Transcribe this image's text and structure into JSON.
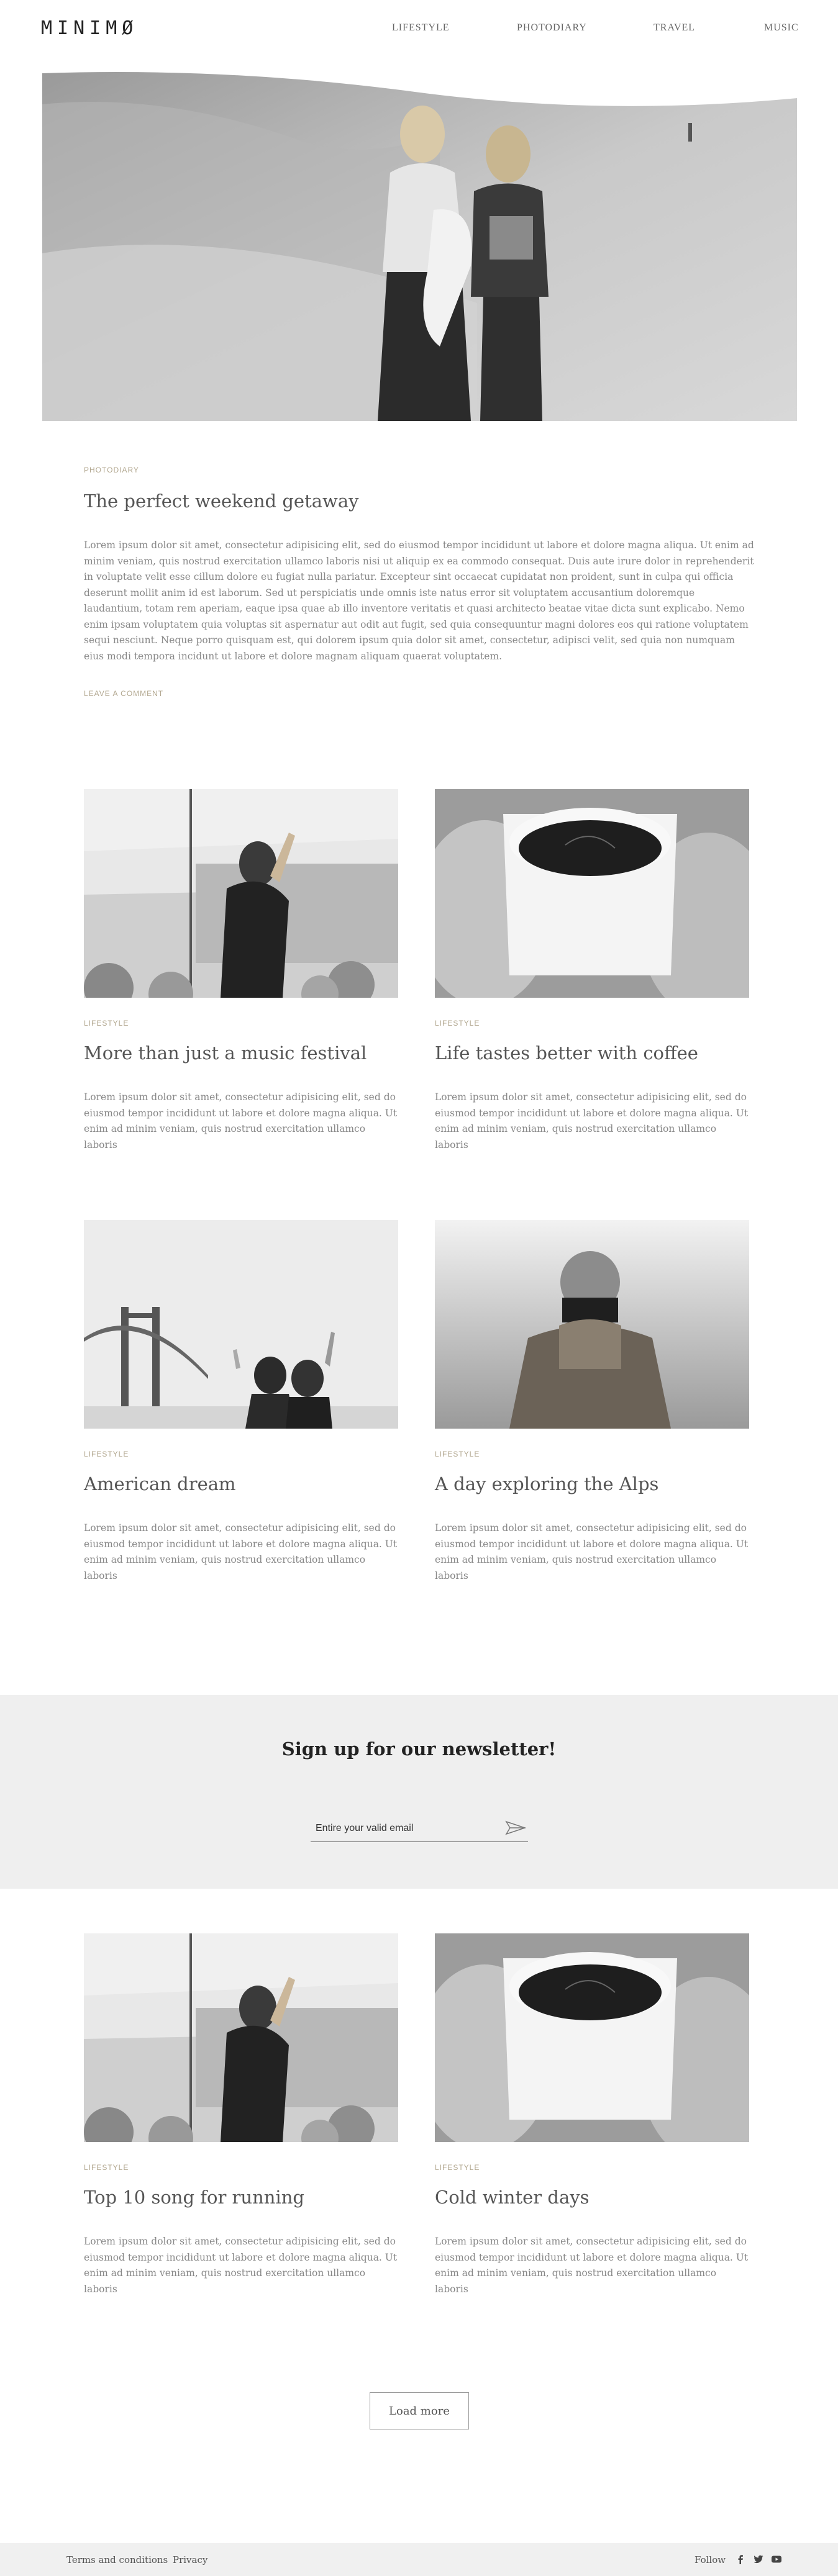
{
  "header": {
    "logo": "MINIMØ",
    "nav": [
      "LIFESTYLE",
      "PHOTODIARY",
      "TRAVEL",
      "MUSIC"
    ]
  },
  "featured": {
    "category": "PHOTODIARY",
    "title": "The perfect weekend getaway",
    "body": "Lorem ipsum dolor sit amet, consectetur adipisicing elit, sed do eiusmod tempor incididunt ut labore et dolore magna aliqua. Ut enim ad minim veniam, quis nostrud exercitation ullamco laboris nisi ut aliquip ex ea commodo consequat. Duis aute irure dolor in reprehenderit in voluptate velit esse cillum dolore eu fugiat nulla pariatur. Excepteur sint occaecat cupidatat non proident, sunt in culpa qui officia deserunt mollit anim id est laborum. Sed ut perspiciatis unde omnis iste natus error sit voluptatem accusantium doloremque laudantium, totam rem aperiam, eaque ipsa quae ab illo inventore veritatis et quasi architecto beatae vitae dicta sunt explicabo. Nemo enim ipsam voluptatem quia voluptas sit aspernatur aut odit aut fugit, sed quia consequuntur magni dolores eos qui ratione voluptatem sequi nesciunt. Neque porro quisquam est, qui dolorem ipsum quia dolor sit amet, consectetur, adipisci velit, sed quia non numquam eius modi tempora incidunt ut labore et dolore magnam aliquam quaerat voluptatem.",
    "leave_comment": "LEAVE A COMMENT"
  },
  "posts": [
    {
      "category": "LIFESTYLE",
      "title": "More than just a music festival",
      "body": "Lorem ipsum dolor sit amet, consectetur adipisicing elit, sed do eiusmod tempor incididunt ut labore et dolore magna aliqua. Ut enim ad minim veniam, quis nostrud exercitation ullamco laboris"
    },
    {
      "category": "LIFESTYLE",
      "title": "Life tastes better with coffee",
      "body": "Lorem ipsum dolor sit amet, consectetur adipisicing elit, sed do eiusmod tempor incididunt ut labore et dolore magna aliqua. Ut enim ad minim veniam, quis nostrud exercitation ullamco laboris"
    },
    {
      "category": "LIFESTYLE",
      "title": "American dream",
      "body": "Lorem ipsum dolor sit amet, consectetur adipisicing elit, sed do eiusmod tempor incididunt ut labore et dolore magna aliqua. Ut enim ad minim veniam, quis nostrud exercitation ullamco laboris"
    },
    {
      "category": "LIFESTYLE",
      "title": "A day exploring the Alps",
      "body": "Lorem ipsum dolor sit amet, consectetur adipisicing elit, sed do eiusmod tempor incididunt ut labore et dolore magna aliqua. Ut enim ad minim veniam, quis nostrud exercitation ullamco laboris"
    },
    {
      "category": "LIFESTYLE",
      "title": "Top 10 song for running",
      "body": "Lorem ipsum dolor sit amet, consectetur adipisicing elit, sed do eiusmod tempor incididunt ut labore et dolore magna aliqua. Ut enim ad minim veniam, quis nostrud exercitation ullamco laboris"
    },
    {
      "category": "LIFESTYLE",
      "title": "Cold winter days",
      "body": "Lorem ipsum dolor sit amet, consectetur adipisicing elit, sed do eiusmod tempor incididunt ut labore et dolore magna aliqua. Ut enim ad minim veniam, quis nostrud exercitation ullamco laboris"
    }
  ],
  "newsletter": {
    "title": "Sign up for our newsletter!",
    "placeholder": "Entire your valid email",
    "send_icon": "paper-plane-icon"
  },
  "load_more": "Load more",
  "footer": {
    "terms": "Terms and conditions",
    "privacy": "Privacy",
    "follow": "Follow",
    "social_icons": [
      "facebook-icon",
      "twitter-icon",
      "youtube-icon"
    ]
  },
  "colors": {
    "accent": "#b2a78f",
    "newsletter_bg": "#efefef",
    "footer_bg": "#f0f0f0",
    "text": "#555555"
  }
}
